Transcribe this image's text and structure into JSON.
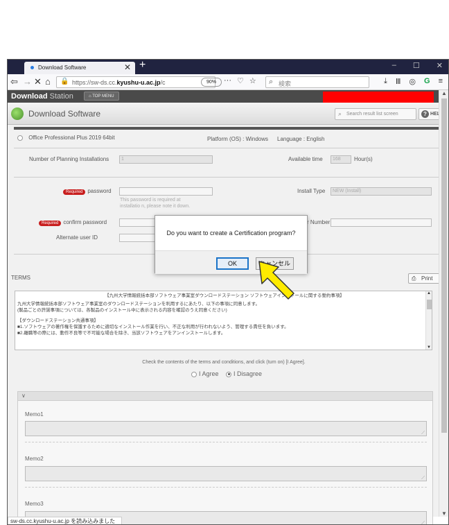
{
  "browser": {
    "tab_title": "Download Software",
    "tab_close": "✕",
    "new_tab": "+",
    "win_min": "–",
    "win_max": "☐",
    "win_close": "✕",
    "url_plain": "https://sw-ds.cc.",
    "url_bold": "kyushu-u.ac.jp",
    "url_tail": "/c",
    "zoom": "90%",
    "search_placeholder": "検索",
    "status": "sw-ds.cc.kyushu-u.ac.jp を読み込みました"
  },
  "app": {
    "brand_bold": "Download",
    "brand_light": "Station",
    "topmenu": "TOP MENU",
    "page_title": "Download Software",
    "search_result": "Search result list screen",
    "help": "HELP"
  },
  "form": {
    "product": "Office Professional Plus 2019 64bit",
    "platform": "Platform (OS) : Windows",
    "language": "Language : English",
    "planning_label": "Number of Planning Installations",
    "planning_value": "1",
    "available_label": "Available time",
    "available_value": "168",
    "hours": "Hour(s)",
    "required_badge": "Required",
    "password_label": "password",
    "password_hint": "This password is required at installatio n, please note it down.",
    "install_type_label": "Install Type",
    "install_type_value": "NEW (Install)",
    "confirm_label": "confirm password",
    "serial_label": "r Number",
    "alternate_label": "Alternate user ID"
  },
  "terms": {
    "header": "TERMS",
    "print": "Print",
    "lines": [
      "【九州大学情報統括本部ソフトウェア事業室ダウンロードステーション ソフトウェアインストールに関する誓約事項】",
      "九州大学情報統括本部ソフトウェア事業室のダウンロードステーションを利用するにあたり、以下の事項に同意します。",
      "(製品ごとの許諾事項については、各製品のインストール中に表示される内容を確認のうえ同意ください)",
      "",
      "【ダウンロードステーション共通事項】",
      "■1.ソフトウェアの著作権を保護するために適切なインストール作業を行い、不正な利用が行われないよう、管理する責任を負います。",
      "■2.離職等の際には、動作不良等で不可能な場合を除き、当該ソフトウェアをアンインストールします。"
    ],
    "check_text": "Check the contents of the terms and conditions, and click (turn on) [I Agree].",
    "agree": "I Agree",
    "disagree": "I Disagree"
  },
  "memos": {
    "toggle": "∨",
    "memo1": "Memo1",
    "memo2": "Memo2",
    "memo3": "Memo3"
  },
  "dialog": {
    "message": "Do you want to create a Certification program?",
    "ok": "OK",
    "cancel": "キャンセル"
  }
}
